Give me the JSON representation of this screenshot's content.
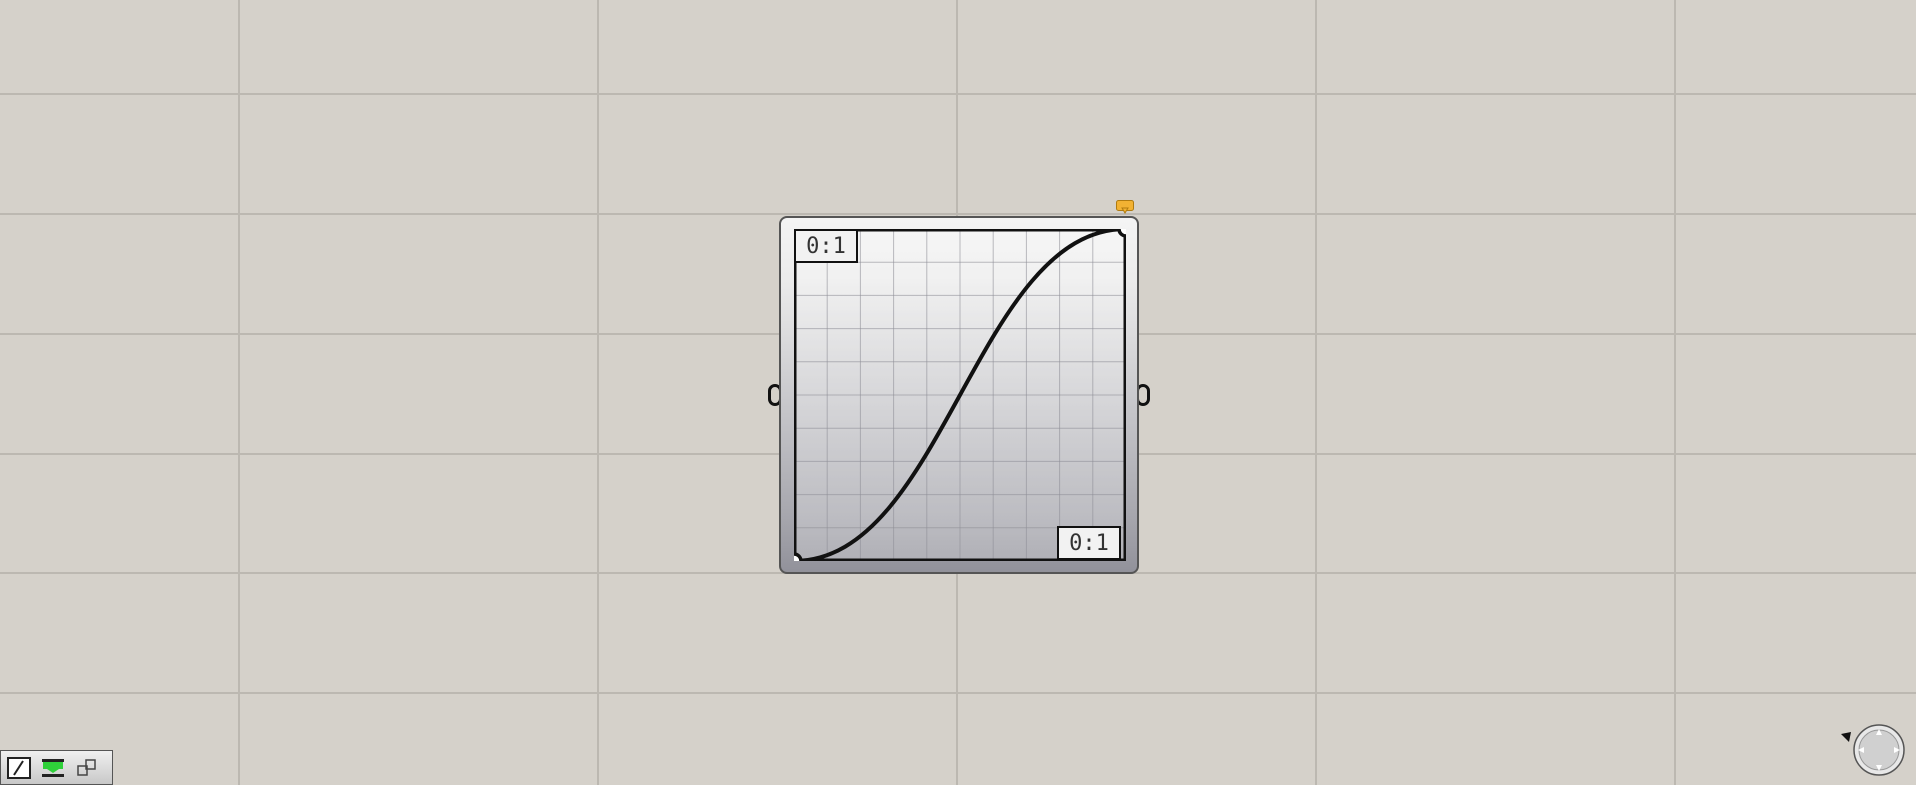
{
  "canvas": {
    "background_color": "#d5d1ca",
    "grid_color": "#bcb8b1"
  },
  "graph_mapper": {
    "graph_type": "bezier",
    "x_domain_label": "0:1",
    "y_domain_label": "0:1",
    "curve_color": "#111111",
    "grid_divisions": 10,
    "curve_points": [
      {
        "x": 0.0,
        "y": 0.0
      },
      {
        "x": 1.0,
        "y": 1.0
      }
    ],
    "input_icon": "input-grip-icon",
    "output_icon": "output-grip-icon",
    "flag_icon": "preview-flag-icon",
    "flag_color": "#f2b233"
  },
  "toolbar": {
    "buttons": [
      {
        "icon": "sketch-icon"
      },
      {
        "icon": "green-bar-icon"
      },
      {
        "icon": "cluster-icon"
      }
    ]
  },
  "navigation": {
    "compass_icon": "compass-icon",
    "arrow_icon": "cursor-arrow-icon"
  }
}
